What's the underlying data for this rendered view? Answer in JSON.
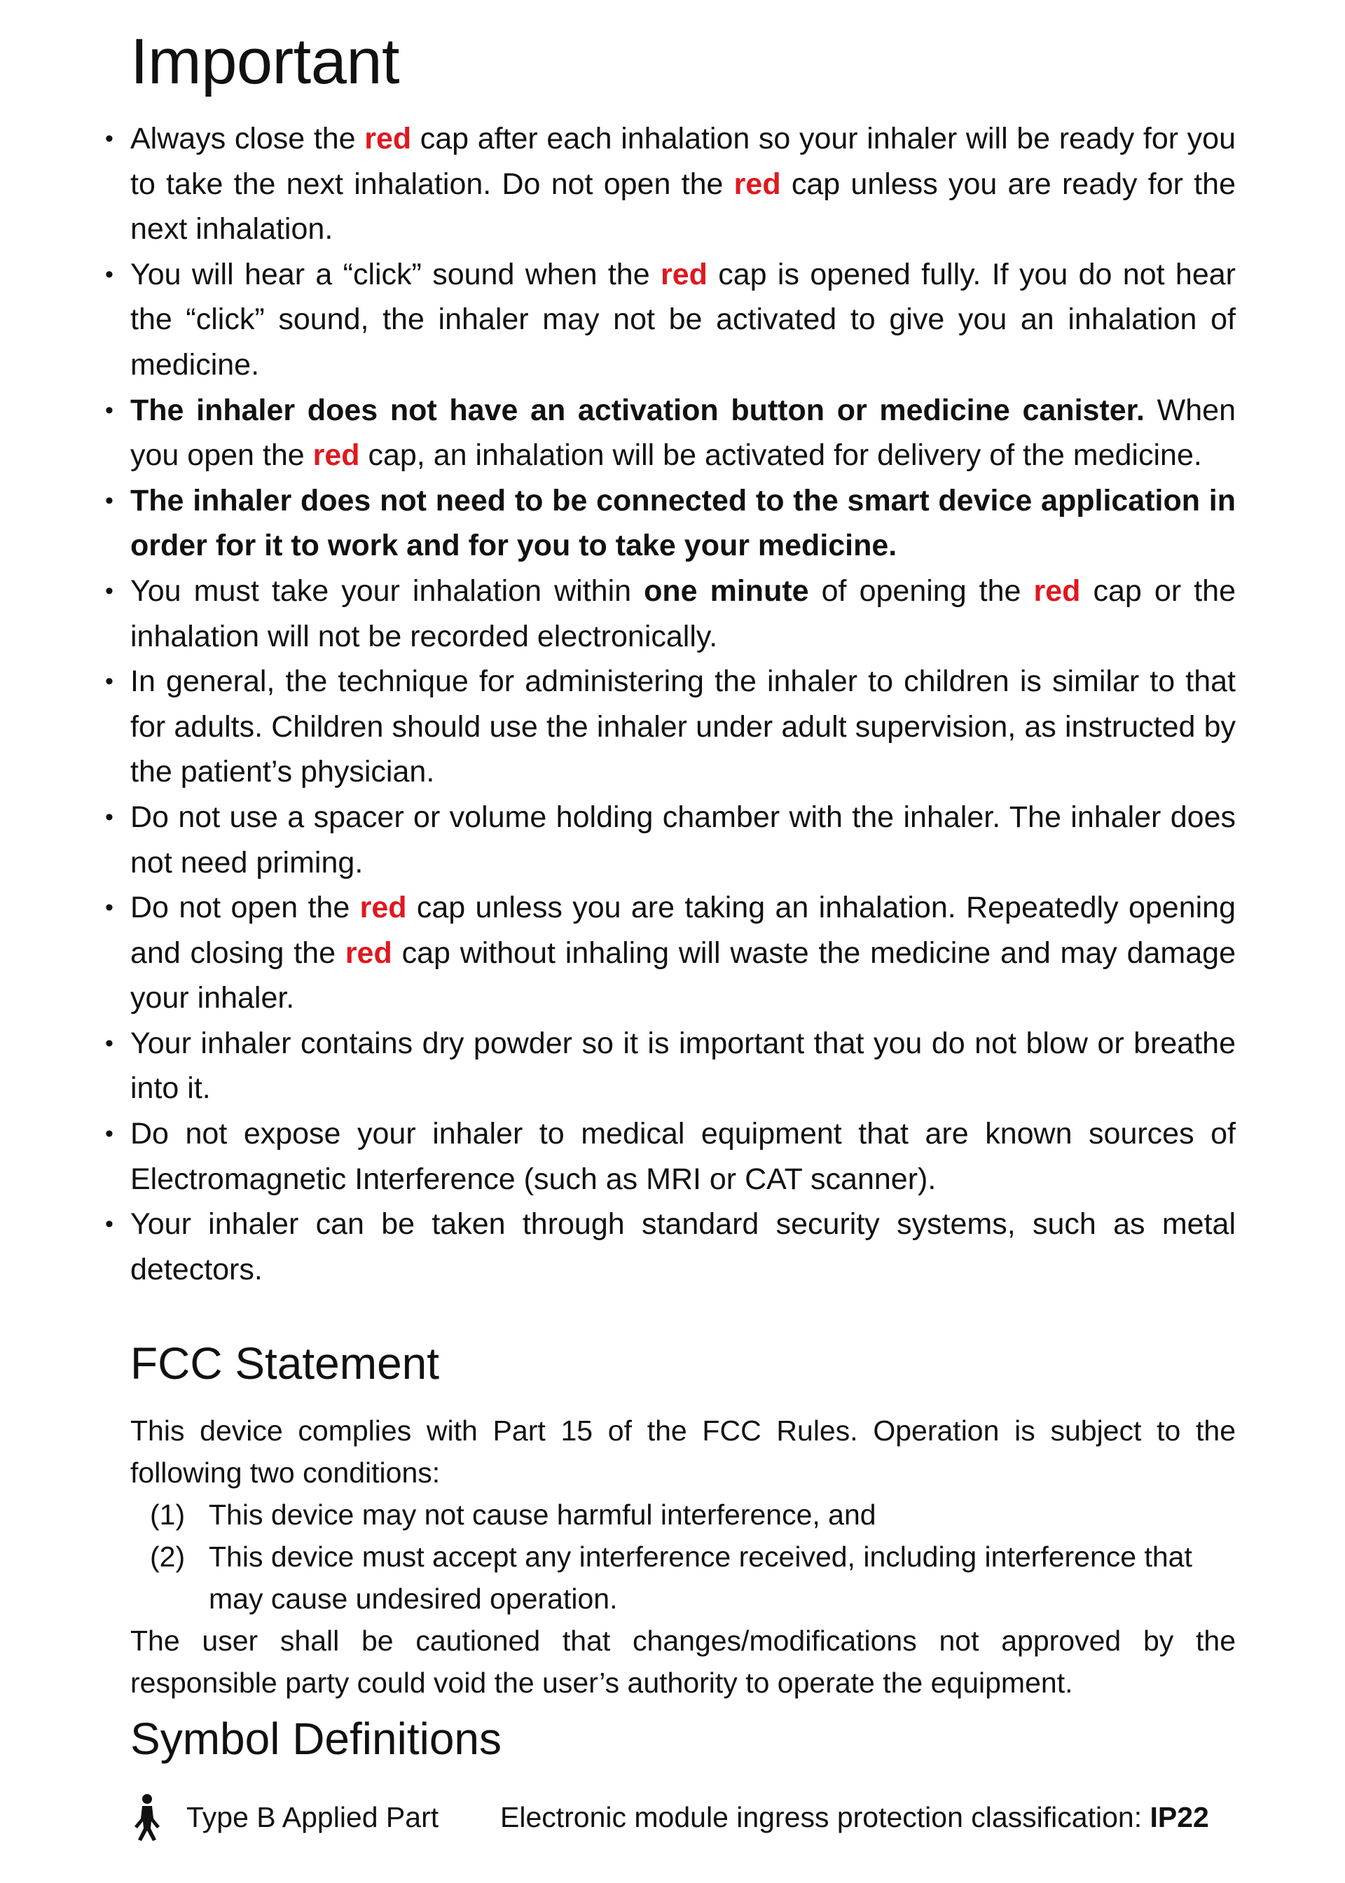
{
  "important": {
    "heading": "Important",
    "bullet_glyph": "•",
    "items": [
      {
        "p1": "Always close the ",
        "r1": "red",
        "p2": " cap after each inhalation so your inhaler will be ready for you to take the next inhalation. Do not open the ",
        "r2": "red",
        "p3": " cap unless you are ready for the next inhalation."
      },
      {
        "p1": "You will hear a “click” sound when the ",
        "r1": "red",
        "p2": " cap is opened fully. If you do not hear the “click” sound, the inhaler may not be activated to give you an inhalation of medicine."
      },
      {
        "b1": "The inhaler does not have an activation button or medicine canister.",
        "p1": " When you open the ",
        "r1": "red",
        "p2": " cap, an inhalation will be activated for delivery of the medicine."
      },
      {
        "b1": "The inhaler does not need to be connected to the smart device application in order for it to work and for you to take your medicine."
      },
      {
        "p1": "You must take your inhalation within ",
        "b1": "one minute",
        "p2": " of opening the ",
        "r1": "red",
        "p3": " cap or the inhalation will not be recorded electronically."
      },
      {
        "p1": "In general, the technique for administering the inhaler to children is similar to that for adults. Children should use the inhaler under adult supervision, as instructed by the patient’s physician."
      },
      {
        "p1": "Do not use a spacer or volume holding chamber with the inhaler. The inhaler does not need priming."
      },
      {
        "p1": "Do not open the ",
        "r1": "red",
        "p2": " cap unless you are taking an inhalation. Repeatedly opening and closing the ",
        "r2": "red",
        "p3": " cap without inhaling will waste the medicine and may damage your inhaler."
      },
      {
        "p1": "Your inhaler contains dry powder so it is important that you do not blow or breathe into it."
      },
      {
        "p1": "Do not expose your inhaler to medical equipment that are known sources of Electromagnetic Interference (such as MRI or CAT scanner)."
      },
      {
        "p1": "Your inhaler can be taken through standard security systems, such as metal detectors."
      }
    ]
  },
  "fcc": {
    "heading": "FCC Statement",
    "intro": "This device complies with Part 15 of the FCC Rules. Operation is subject to the following two conditions:",
    "conditions": [
      {
        "num": "(1)",
        "text": "This device may not cause harmful interference, and"
      },
      {
        "num": "(2)",
        "text": "This device must accept any interference received, including interference that may cause undesired operation."
      }
    ],
    "note": "The user shall be cautioned that changes/modifications not approved by the responsible party could void the user’s authority to operate the equipment."
  },
  "symbols": {
    "heading": "Symbol Definitions",
    "icon": "type-b-applied-part-icon",
    "type_b_label": "Type B Applied Part",
    "ingress_label": "Electronic module ingress protection classification: ",
    "ingress_code": "IP22"
  },
  "colors": {
    "accent_red": "#e0181f",
    "text": "#111111",
    "background": "#ffffff"
  }
}
